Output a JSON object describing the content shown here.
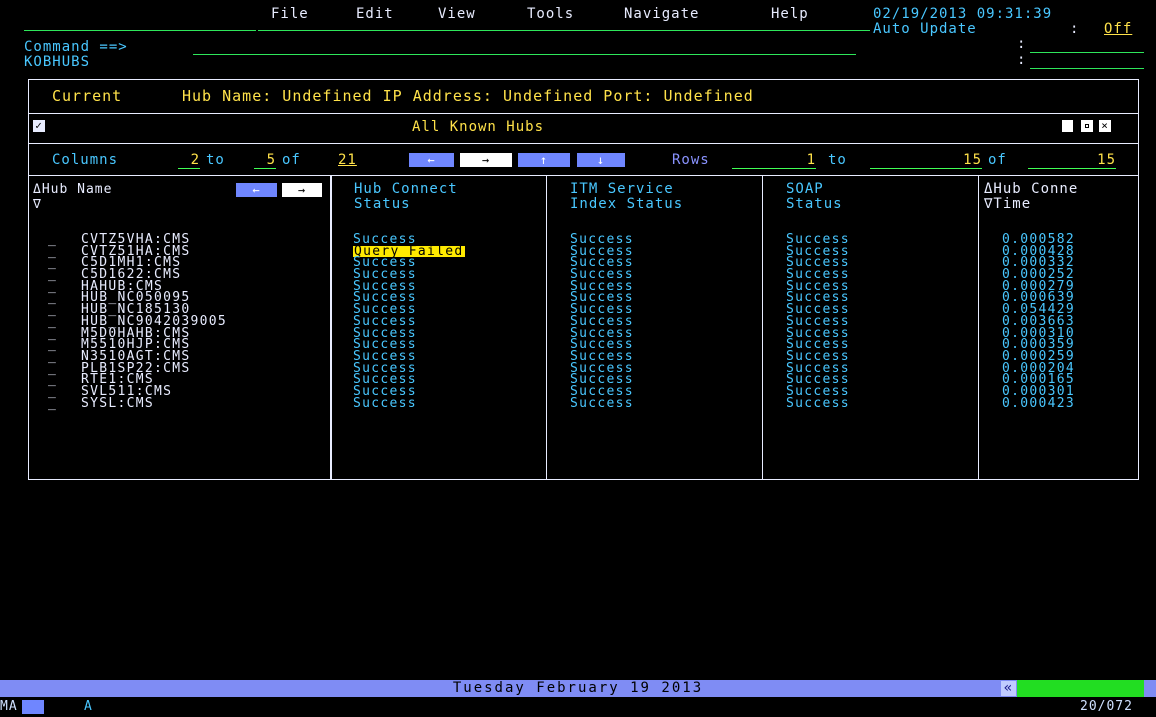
{
  "menu": {
    "file": "File",
    "edit": "Edit",
    "view": "View",
    "tools": "Tools",
    "navigate": "Navigate",
    "help": "Help"
  },
  "datetime": "02/19/2013 09:31:39",
  "auto_update": {
    "label": "Auto Update",
    "sep": ":",
    "value": "Off"
  },
  "command": {
    "label": "Command ==>",
    "value": ""
  },
  "workspace_name": "KOBHUBS",
  "current": {
    "label": "Current",
    "text": "Hub Name: Undefined IP Address: Undefined Port: Undefined"
  },
  "panel": {
    "title": "All Known Hubs",
    "columns_label": "Columns",
    "col_from": "2",
    "col_to_word": "to",
    "col_to": "5",
    "col_of_word": "of",
    "col_total": "21",
    "rows_label": "Rows",
    "row_from": "1",
    "row_to_word": "to",
    "row_to": "15",
    "row_of_word": "of",
    "row_total": "15"
  },
  "headers": {
    "hub_name": "ΔHub Name\n∇",
    "hub_connect": "Hub Connect\nStatus",
    "itm_service": "ITM Service\nIndex Status",
    "soap": "SOAP\nStatus",
    "hub_time": "ΔHub Conne\n∇Time"
  },
  "rows": [
    {
      "sel": "_",
      "name": "CVTZ5VHA:CMS",
      "connect": "Success",
      "itm": "Success",
      "soap": "Success",
      "time": "0.000582"
    },
    {
      "sel": "_",
      "name": "CVTZ51HA:CMS",
      "connect": "Query Failed",
      "itm": "Success",
      "soap": "Success",
      "time": "0.000428"
    },
    {
      "sel": "_",
      "name": "C5D1MH1:CMS",
      "connect": "Success",
      "itm": "Success",
      "soap": "Success",
      "time": "0.000332"
    },
    {
      "sel": "_",
      "name": "C5D1622:CMS",
      "connect": "Success",
      "itm": "Success",
      "soap": "Success",
      "time": "0.000252"
    },
    {
      "sel": "_",
      "name": "HAHUB:CMS",
      "connect": "Success",
      "itm": "Success",
      "soap": "Success",
      "time": "0.000279"
    },
    {
      "sel": "_",
      "name": "HUB_NC050095",
      "connect": "Success",
      "itm": "Success",
      "soap": "Success",
      "time": "0.000639"
    },
    {
      "sel": "_",
      "name": "HUB_NC185130",
      "connect": "Success",
      "itm": "Success",
      "soap": "Success",
      "time": "0.054429"
    },
    {
      "sel": "_",
      "name": "HUB_NC9042039005",
      "connect": "Success",
      "itm": "Success",
      "soap": "Success",
      "time": "0.003663"
    },
    {
      "sel": "_",
      "name": "M5D0HAHB:CMS",
      "connect": "Success",
      "itm": "Success",
      "soap": "Success",
      "time": "0.000310"
    },
    {
      "sel": "_",
      "name": "M5510HJP:CMS",
      "connect": "Success",
      "itm": "Success",
      "soap": "Success",
      "time": "0.000359"
    },
    {
      "sel": "_",
      "name": "N3510AGT:CMS",
      "connect": "Success",
      "itm": "Success",
      "soap": "Success",
      "time": "0.000259"
    },
    {
      "sel": "_",
      "name": "PLB1SP22:CMS",
      "connect": "Success",
      "itm": "Success",
      "soap": "Success",
      "time": "0.000204"
    },
    {
      "sel": "_",
      "name": "RTE1:CMS",
      "connect": "Success",
      "itm": "Success",
      "soap": "Success",
      "time": "0.000165"
    },
    {
      "sel": "_",
      "name": "SVL511:CMS",
      "connect": "Success",
      "itm": "Success",
      "soap": "Success",
      "time": "0.000301"
    },
    {
      "sel": "_",
      "name": "SYSL:CMS",
      "connect": "Success",
      "itm": "Success",
      "soap": "Success",
      "time": "0.000423"
    }
  ],
  "footer_date": "Tuesday February 19 2013",
  "footer_indicator": "«",
  "bottom": {
    "left": "MA",
    "mid": "A",
    "right": "20/072"
  },
  "colors": {
    "accent": "#6f86ff",
    "highlight": "#ffea00",
    "input_line": "#2ee65a"
  }
}
